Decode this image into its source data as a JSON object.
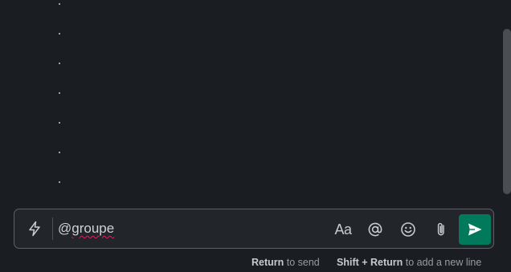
{
  "messages": {
    "dot_count": 7
  },
  "composer": {
    "input_prefix": "@",
    "input_word": "groupe",
    "tools": {
      "formatting_label": "Aa",
      "formatting_icon": "formatting-icon",
      "mention_icon": "at-icon",
      "emoji_icon": "smiley-icon",
      "attach_icon": "paperclip-icon",
      "shortcut_icon": "lightning-icon",
      "send_icon": "paper-plane-icon"
    },
    "send_color": "#007a5a"
  },
  "hints": {
    "send_key": "Return",
    "send_text": " to send",
    "newline_key": "Shift + Return",
    "newline_text": " to add a new line"
  },
  "colors": {
    "background": "#1a1d21",
    "composer_bg": "#222529",
    "composer_border": "#5e6066",
    "accent": "#007a5a",
    "spellcheck": "#e01e5a"
  }
}
